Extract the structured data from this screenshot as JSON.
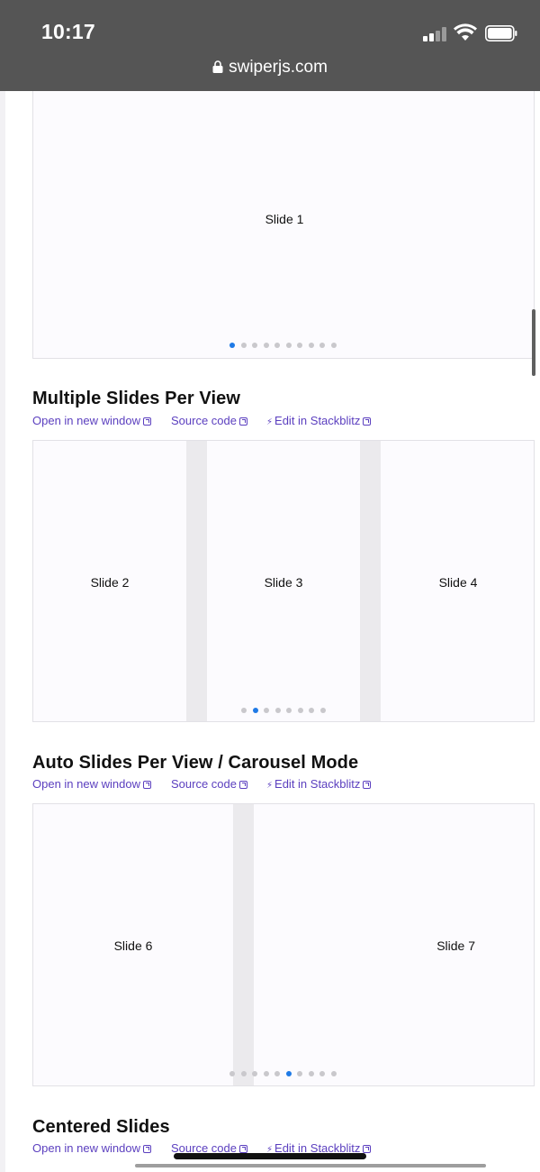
{
  "status_bar": {
    "time": "10:17"
  },
  "browser": {
    "url": "swiperjs.com"
  },
  "sections": [
    {
      "slides": [
        "Slide 1"
      ],
      "pagination_count": 10,
      "pagination_active": 1
    },
    {
      "title": "Multiple Slides Per View",
      "links": {
        "open": "Open in new window",
        "source": "Source code",
        "edit": "Edit in Stackblitz"
      },
      "slides": [
        "Slide 2",
        "Slide 3",
        "Slide 4"
      ],
      "pagination_count": 8,
      "pagination_active": 2
    },
    {
      "title": "Auto Slides Per View / Carousel Mode",
      "links": {
        "open": "Open in new window",
        "source": "Source code",
        "edit": "Edit in Stackblitz"
      },
      "slides": [
        "Slide 6",
        "Slide 7"
      ],
      "pagination_count": 10,
      "pagination_active": 6
    },
    {
      "title": "Centered Slides",
      "links": {
        "open": "Open in new window",
        "source": "Source code",
        "edit": "Edit in Stackblitz"
      }
    }
  ],
  "colors": {
    "accent_link": "#5b3fbf",
    "pagination_active": "#1f7ae6",
    "status_bar_bg": "#555555"
  },
  "icons": [
    "lock-icon",
    "wifi-icon",
    "battery-icon",
    "signal-icon",
    "external-link-icon",
    "bolt-icon"
  ]
}
